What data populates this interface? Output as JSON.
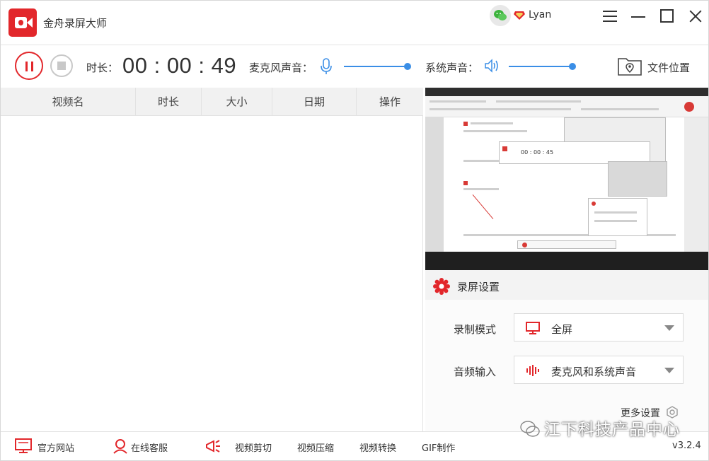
{
  "app": {
    "title": "金舟录屏大师",
    "username": "Lyan",
    "accent": "#e2272b"
  },
  "controls": {
    "duration_label": "时长：",
    "duration_value": "00 : 00 : 49",
    "mic_label": "麦克风声音：",
    "mic_level": 0.98,
    "system_label": "系统声音：",
    "system_level": 0.98,
    "folder_label": "文件位置"
  },
  "table": {
    "columns": [
      "视频名",
      "时长",
      "大小",
      "日期",
      "操作"
    ],
    "rows": []
  },
  "preview_window": {
    "timer": "00 : 00 : 45"
  },
  "settings": {
    "title": "录屏设置",
    "record_mode_label": "录制模式",
    "record_mode_value": "全屏",
    "audio_input_label": "音频输入",
    "audio_input_value": "麦克风和系统声音",
    "more_label": "更多设置"
  },
  "footer": {
    "website": "官方网站",
    "support": "在线客服",
    "cut": "视频剪切",
    "compress": "视频压缩",
    "convert": "视频转换",
    "gif": "GIF制作",
    "version": "v3.2.4"
  },
  "watermark": "江下科技产品中心"
}
